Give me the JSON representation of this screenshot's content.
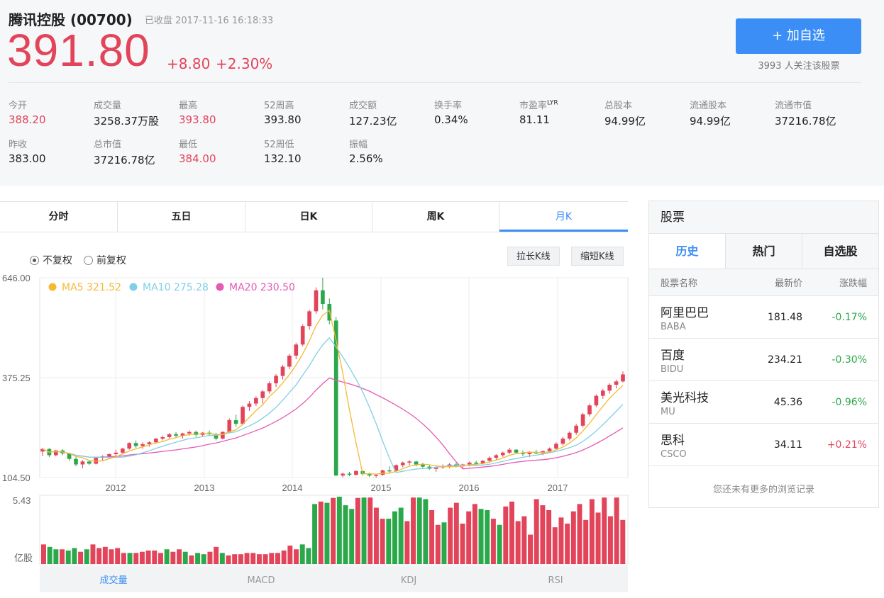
{
  "header": {
    "title": "腾讯控股 (00700)",
    "status": "已收盘 2017-11-16  16:18:33",
    "price": "391.80",
    "change": "+8.80",
    "change_pct": "+2.30%",
    "add_button": "+ 加自选",
    "followers": "3993 人关注该股票",
    "accent_color": "#3a8ef6",
    "up_color": "#e2445a",
    "down_color": "#2aa84a"
  },
  "stats": [
    {
      "label": "今开",
      "value": "388.20",
      "red": true
    },
    {
      "label": "成交量",
      "value": "3258.37万股",
      "red": false
    },
    {
      "label": "最高",
      "value": "393.80",
      "red": true
    },
    {
      "label": "52周高",
      "value": "393.80",
      "red": false
    },
    {
      "label": "成交额",
      "value": "127.23亿",
      "red": false
    },
    {
      "label": "换手率",
      "value": "0.34%",
      "red": false
    },
    {
      "label": "市盈率",
      "sup": "LYR",
      "value": "81.11",
      "red": false
    },
    {
      "label": "总股本",
      "value": "94.99亿",
      "red": false
    },
    {
      "label": "流通股本",
      "value": "94.99亿",
      "red": false
    },
    {
      "label": "流通市值",
      "value": "37216.78亿",
      "red": false
    },
    {
      "label": "昨收",
      "value": "383.00",
      "red": false
    },
    {
      "label": "总市值",
      "value": "37216.78亿",
      "red": false
    },
    {
      "label": "最低",
      "value": "384.00",
      "red": true
    },
    {
      "label": "52周低",
      "value": "132.10",
      "red": false
    },
    {
      "label": "振幅",
      "value": "2.56%",
      "red": false
    }
  ],
  "tabs": [
    "分时",
    "五日",
    "日K",
    "周K",
    "月K"
  ],
  "active_tab": "月K",
  "adjust": {
    "option1": "不复权",
    "option2": "前复权",
    "selected": "不复权"
  },
  "buttons": {
    "longer": "拉长K线",
    "shorter": "缩短K线"
  },
  "chart_data": {
    "type": "candlestick",
    "period": "monthly",
    "y_ticks": [
      "646.00",
      "375.25",
      "104.50"
    ],
    "ylim": [
      104.5,
      646
    ],
    "x_ticks": [
      "2012",
      "2013",
      "2014",
      "2015",
      "2016",
      "2017"
    ],
    "legend": [
      {
        "name": "MA5",
        "value": "321.52",
        "color": "#f5b932"
      },
      {
        "name": "MA10",
        "value": "275.28",
        "color": "#7fcfe6"
      },
      {
        "name": "MA20",
        "value": "230.50",
        "color": "#e55ab3"
      }
    ],
    "candles": [
      [
        175,
        185,
        162,
        182
      ],
      [
        182,
        184,
        160,
        165
      ],
      [
        165,
        180,
        162,
        178
      ],
      [
        178,
        182,
        165,
        170
      ],
      [
        170,
        172,
        150,
        155
      ],
      [
        155,
        160,
        135,
        140
      ],
      [
        140,
        152,
        130,
        148
      ],
      [
        148,
        150,
        138,
        142
      ],
      [
        142,
        160,
        140,
        158
      ],
      [
        158,
        165,
        150,
        162
      ],
      [
        162,
        170,
        158,
        168
      ],
      [
        168,
        180,
        160,
        172
      ],
      [
        172,
        185,
        170,
        183
      ],
      [
        183,
        200,
        180,
        198
      ],
      [
        198,
        205,
        185,
        190
      ],
      [
        190,
        200,
        182,
        195
      ],
      [
        195,
        203,
        188,
        200
      ],
      [
        200,
        212,
        196,
        210
      ],
      [
        210,
        218,
        205,
        214
      ],
      [
        214,
        225,
        210,
        222
      ],
      [
        222,
        228,
        212,
        218
      ],
      [
        218,
        226,
        210,
        224
      ],
      [
        224,
        232,
        218,
        228
      ],
      [
        228,
        232,
        215,
        220
      ],
      [
        220,
        228,
        214,
        226
      ],
      [
        226,
        232,
        218,
        222
      ],
      [
        222,
        226,
        205,
        210
      ],
      [
        210,
        230,
        208,
        228
      ],
      [
        228,
        265,
        225,
        260
      ],
      [
        260,
        275,
        242,
        250
      ],
      [
        250,
        300,
        248,
        296
      ],
      [
        296,
        312,
        285,
        305
      ],
      [
        305,
        325,
        298,
        320
      ],
      [
        320,
        342,
        305,
        338
      ],
      [
        338,
        365,
        332,
        360
      ],
      [
        360,
        385,
        350,
        380
      ],
      [
        380,
        410,
        370,
        405
      ],
      [
        405,
        440,
        398,
        435
      ],
      [
        435,
        470,
        425,
        465
      ],
      [
        465,
        520,
        460,
        515
      ],
      [
        515,
        560,
        505,
        555
      ],
      [
        555,
        620,
        548,
        612
      ],
      [
        612,
        646,
        560,
        575
      ],
      [
        575,
        590,
        520,
        530
      ],
      [
        530,
        540,
        108,
        110
      ],
      [
        110,
        118,
        105,
        115
      ],
      [
        115,
        120,
        108,
        112
      ],
      [
        112,
        125,
        110,
        122
      ],
      [
        122,
        124,
        110,
        114
      ],
      [
        114,
        118,
        106,
        110
      ],
      [
        110,
        115,
        104,
        112
      ],
      [
        112,
        126,
        110,
        124
      ],
      [
        124,
        135,
        118,
        122
      ],
      [
        122,
        140,
        120,
        138
      ],
      [
        138,
        148,
        132,
        145
      ],
      [
        145,
        152,
        138,
        148
      ],
      [
        148,
        150,
        135,
        140
      ],
      [
        140,
        145,
        130,
        134
      ],
      [
        134,
        138,
        125,
        128
      ],
      [
        128,
        135,
        120,
        132
      ],
      [
        132,
        140,
        128,
        136
      ],
      [
        136,
        144,
        130,
        140
      ],
      [
        140,
        145,
        132,
        135
      ],
      [
        135,
        142,
        128,
        140
      ],
      [
        140,
        148,
        135,
        145
      ],
      [
        145,
        150,
        138,
        142
      ],
      [
        142,
        152,
        140,
        150
      ],
      [
        150,
        162,
        145,
        158
      ],
      [
        158,
        168,
        152,
        165
      ],
      [
        165,
        175,
        160,
        172
      ],
      [
        172,
        185,
        168,
        180
      ],
      [
        180,
        182,
        168,
        172
      ],
      [
        172,
        178,
        162,
        168
      ],
      [
        168,
        176,
        160,
        174
      ],
      [
        174,
        180,
        168,
        170
      ],
      [
        170,
        178,
        165,
        176
      ],
      [
        176,
        186,
        172,
        183
      ],
      [
        183,
        200,
        180,
        196
      ],
      [
        196,
        215,
        192,
        210
      ],
      [
        210,
        230,
        205,
        226
      ],
      [
        226,
        250,
        220,
        245
      ],
      [
        245,
        280,
        240,
        276
      ],
      [
        276,
        305,
        270,
        300
      ],
      [
        300,
        330,
        295,
        326
      ],
      [
        326,
        345,
        318,
        340
      ],
      [
        340,
        360,
        332,
        356
      ],
      [
        356,
        370,
        346,
        365
      ],
      [
        365,
        392,
        362,
        384
      ]
    ],
    "ma5": [
      [
        0,
        150
      ],
      [
        0.05,
        158
      ],
      [
        0.1,
        165
      ],
      [
        0.15,
        152
      ],
      [
        0.2,
        158
      ],
      [
        0.25,
        180
      ],
      [
        0.3,
        200
      ],
      [
        0.35,
        210
      ],
      [
        0.4,
        218
      ],
      [
        0.45,
        222
      ],
      [
        0.5,
        228
      ],
      [
        0.55,
        290
      ],
      [
        0.6,
        360
      ],
      [
        0.65,
        450
      ],
      [
        0.68,
        520
      ],
      [
        0.71,
        540
      ],
      [
        0.73,
        350
      ],
      [
        0.755,
        130
      ],
      [
        0.79,
        112
      ],
      [
        0.82,
        118
      ],
      [
        0.86,
        126
      ],
      [
        0.9,
        136
      ],
      [
        0.93,
        140
      ],
      [
        0.97,
        150
      ],
      [
        1.0,
        164
      ]
    ],
    "volume_ylabel_top": "5.43",
    "volume_ylabel_unit": "亿股",
    "volume_values": [
      1.6,
      1.4,
      1.2,
      1.2,
      1.1,
      1.3,
      1.0,
      1.2,
      1.6,
      1.3,
      1.4,
      1.2,
      1.3,
      0.9,
      0.9,
      0.9,
      1.0,
      1.1,
      1.1,
      0.9,
      1.2,
      1.0,
      1.2,
      1.0,
      0.7,
      0.9,
      0.8,
      1.0,
      1.4,
      0.9,
      0.7,
      0.8,
      0.8,
      0.9,
      0.9,
      0.8,
      0.8,
      0.9,
      0.9,
      1.1,
      1.5,
      1.2,
      1.6,
      1.3,
      4.9,
      5.1,
      5.0,
      5.4,
      5.5,
      4.8,
      4.5,
      5.4,
      5.43,
      5.43,
      4.6,
      3.7,
      3.7,
      4.3,
      4.6,
      3.5,
      5.43,
      5.43,
      5.3,
      4.4,
      3.2,
      3.4,
      4.6,
      5.0,
      3.3,
      4.3,
      4.9,
      4.5,
      4.4,
      3.7,
      3.2,
      4.7,
      5.1,
      3.5,
      3.9,
      2.4,
      5.3,
      4.8,
      4.4,
      3.0,
      3.8,
      3.3,
      4.3,
      4.9,
      3.6,
      5.3,
      4.2,
      5.43,
      3.9,
      5.43,
      3.6
    ],
    "volume_up": [
      1,
      0,
      0,
      1,
      0,
      0,
      1,
      0,
      1,
      1,
      1,
      1,
      1,
      1,
      0,
      1,
      1,
      1,
      1,
      1,
      0,
      1,
      1,
      0,
      1,
      0,
      0,
      1,
      1,
      0,
      1,
      1,
      1,
      1,
      1,
      1,
      1,
      1,
      1,
      1,
      1,
      1,
      0,
      0,
      0,
      1,
      0,
      1,
      0,
      0,
      0,
      1,
      0,
      1,
      1,
      1,
      0,
      0,
      0,
      1,
      1,
      0,
      0,
      1,
      1,
      0,
      1,
      1,
      1,
      1,
      1,
      0,
      0,
      1,
      0,
      1,
      1,
      1,
      1,
      1,
      1,
      1,
      1,
      1,
      1,
      1,
      1,
      1,
      1,
      1,
      1,
      1,
      1,
      1,
      1
    ],
    "bottom_tabs": [
      "成交量",
      "MACD",
      "KDJ",
      "RSI"
    ],
    "active_bottom_tab": "成交量"
  },
  "sidebar": {
    "title": "股票",
    "tabs": [
      "历史",
      "热门",
      "自选股"
    ],
    "active_tab": "历史",
    "columns": [
      "股票名称",
      "最新价",
      "涨跌幅"
    ],
    "rows": [
      {
        "name": "阿里巴巴",
        "code": "BABA",
        "price": "181.48",
        "pct": "-0.17%",
        "up": false
      },
      {
        "name": "百度",
        "code": "BIDU",
        "price": "234.21",
        "pct": "-0.30%",
        "up": false
      },
      {
        "name": "美光科技",
        "code": "MU",
        "price": "45.36",
        "pct": "-0.96%",
        "up": false
      },
      {
        "name": "思科",
        "code": "CSCO",
        "price": "34.11",
        "pct": "+0.21%",
        "up": true
      }
    ],
    "no_more": "您还未有更多的浏览记录"
  }
}
